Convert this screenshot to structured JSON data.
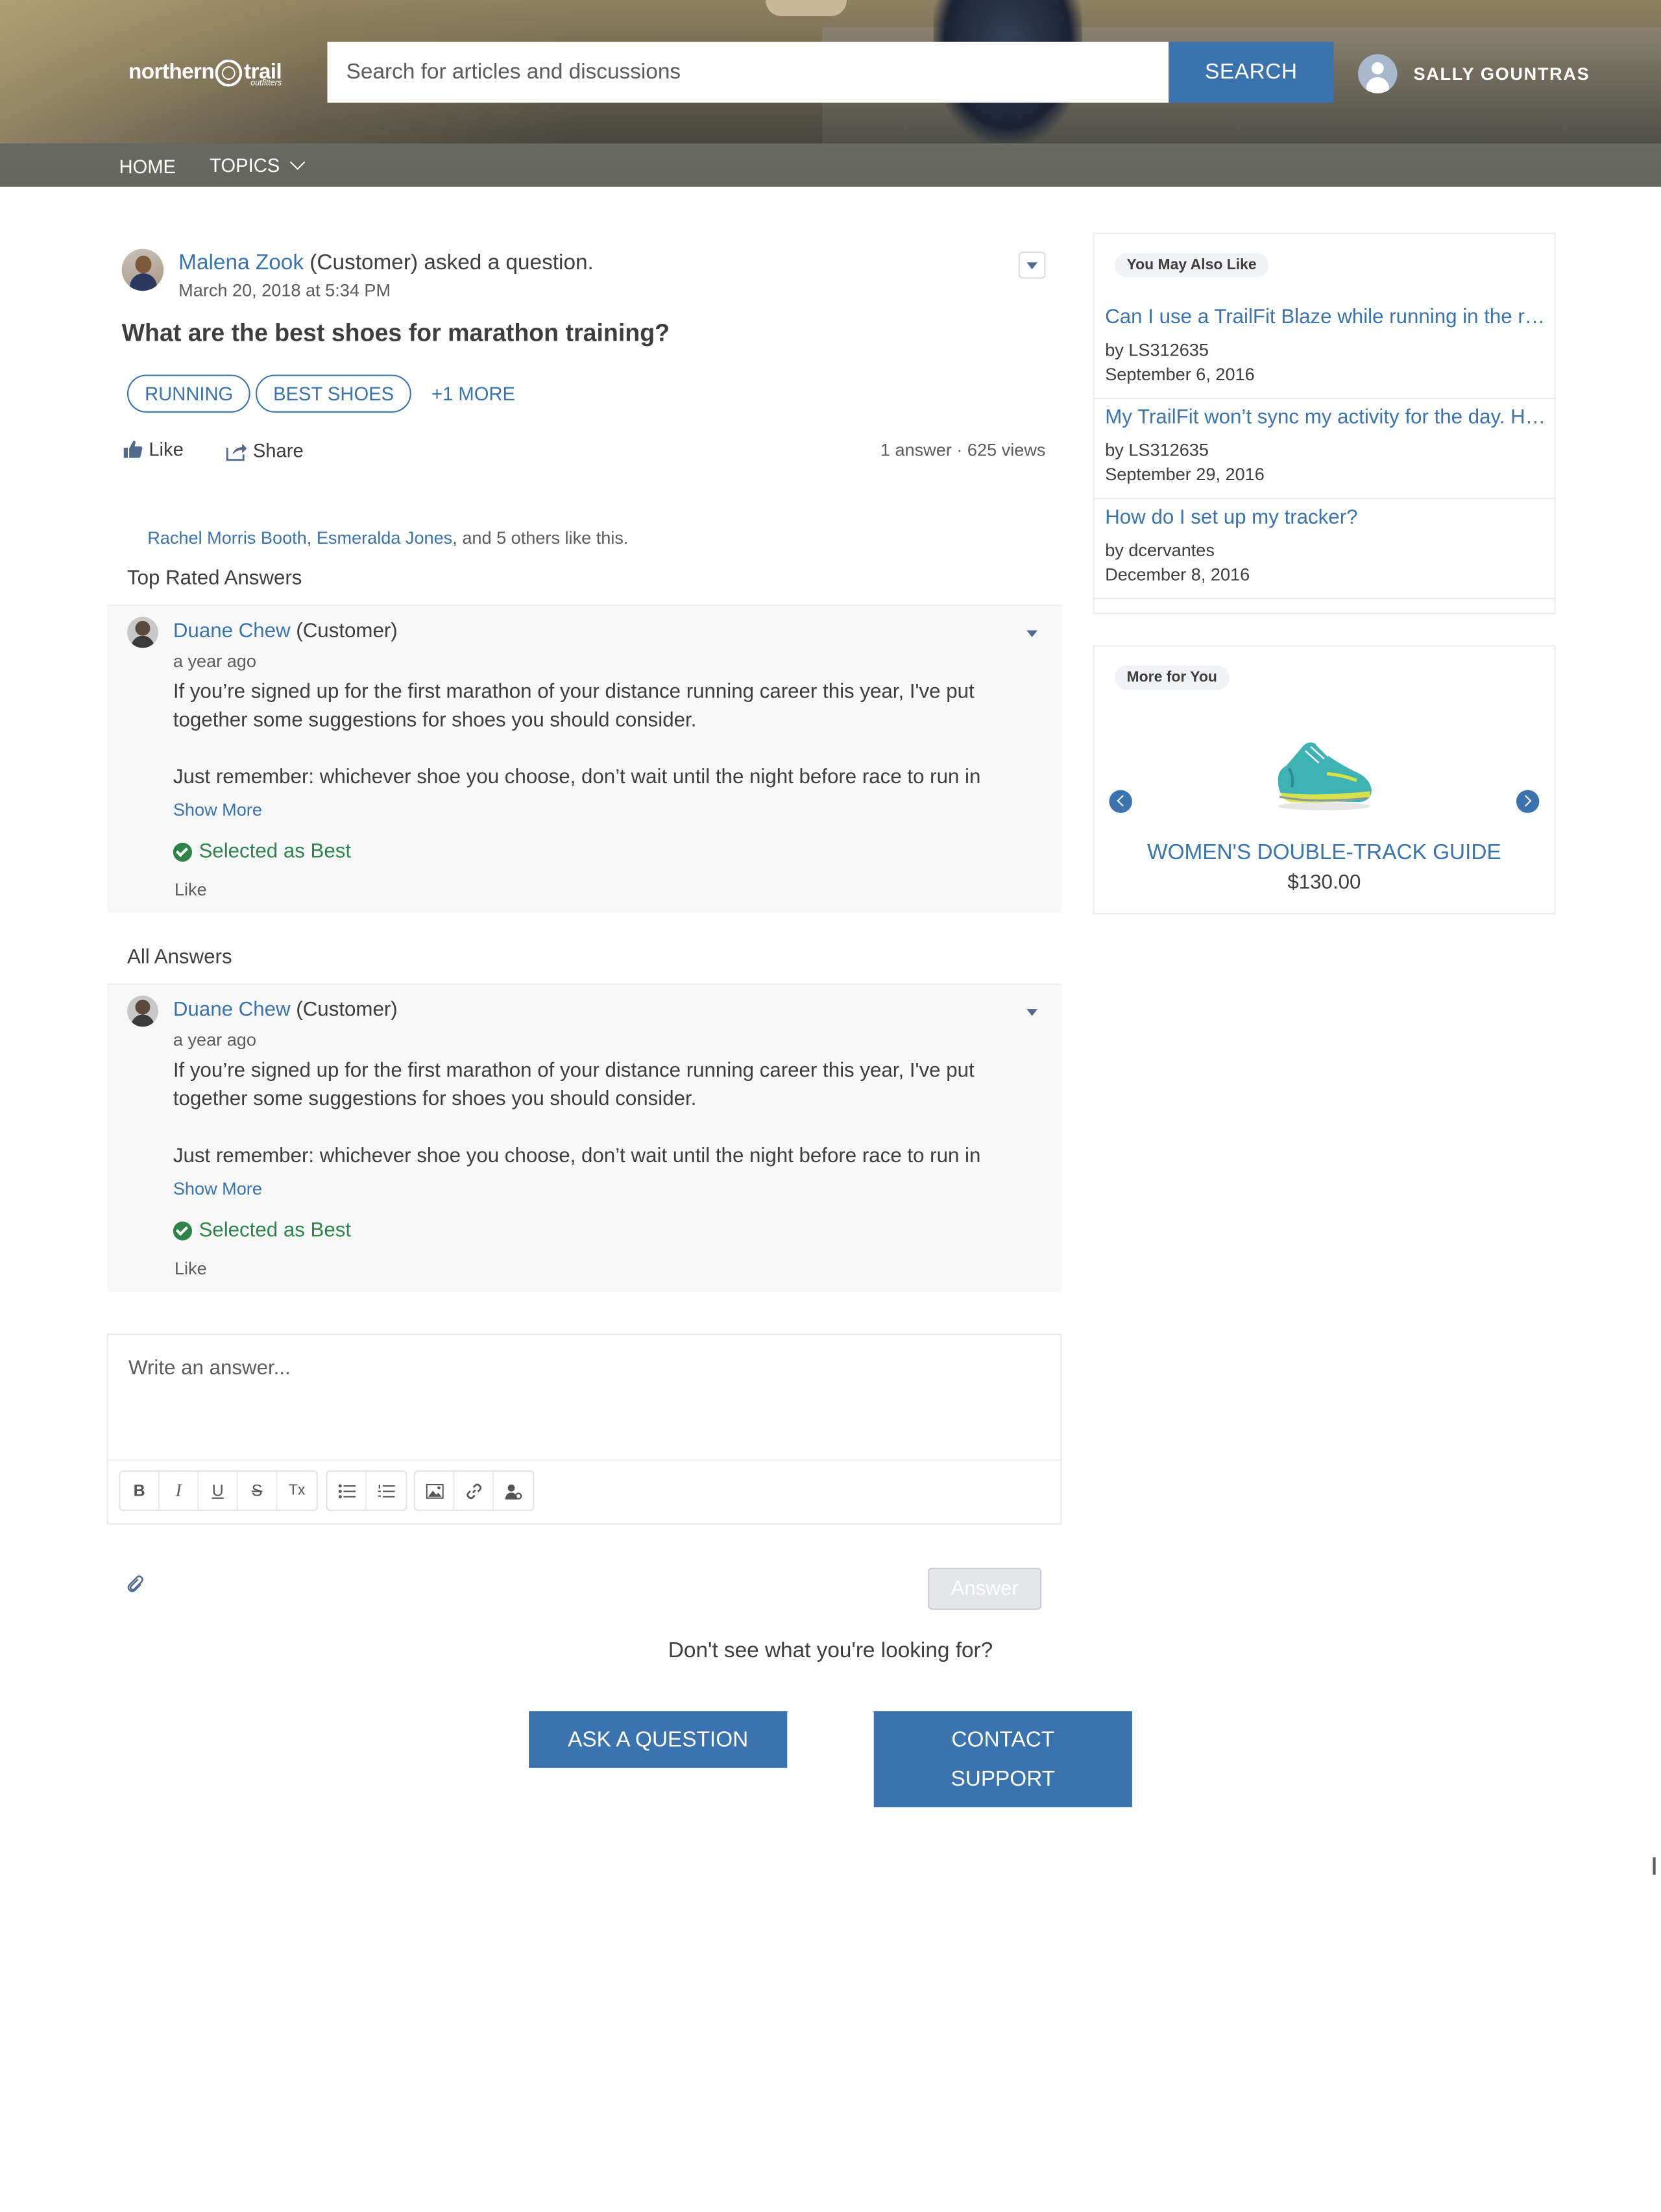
{
  "header": {
    "logo": {
      "word1": "northern",
      "word2": "trail",
      "sub": "outfitters"
    },
    "search": {
      "placeholder": "Search for articles and discussions",
      "button_label": "SEARCH"
    },
    "user": {
      "name": "SALLY GOUNTRAS"
    },
    "nav": {
      "home": "HOME",
      "topics": "TOPICS"
    }
  },
  "question": {
    "author": "Malena Zook",
    "author_suffix": " (Customer) asked a question.",
    "date": "March 20, 2018 at 5:34 PM",
    "title": "What are the best shoes for marathon training?",
    "tags": [
      "RUNNING",
      "BEST SHOES"
    ],
    "more_tags": "+1 MORE",
    "like_label": "Like",
    "share_label": "Share",
    "stats": "1 answer · 625 views",
    "likers": {
      "person1": "Rachel Morris Booth",
      "sep": ", ",
      "person2": "Esmeralda Jones",
      "rest": ", and 5 others like this."
    }
  },
  "sections": {
    "top_rated": "Top Rated Answers",
    "all_answers": "All Answers"
  },
  "answers": {
    "top": {
      "author": "Duane Chew",
      "role": " (Customer)",
      "time": "a year ago",
      "body_p1": "If you’re signed up for the first marathon of your distance running career this year, I've put together some suggestions for shoes you should consider.",
      "body_p2": "Just remember: whichever shoe you choose, don’t wait until the night before race to run in",
      "show_more": "Show More",
      "best_label": "Selected as Best",
      "like_label": "Like"
    },
    "all": {
      "author": "Duane Chew",
      "role": " (Customer)",
      "time": "a year ago",
      "body_p1": "If you’re signed up for the first marathon of your distance running career this year, I've put together some suggestions for shoes you should consider.",
      "body_p2": "Just remember: whichever shoe you choose, don’t wait until the night before race to run in",
      "show_more": "Show More",
      "best_label": "Selected as Best",
      "like_label": "Like"
    }
  },
  "composer": {
    "placeholder": "Write an answer...",
    "toolbar": {
      "bold": "B",
      "italic": "I",
      "underline": "U",
      "strike": "S",
      "clear": "Tx"
    },
    "submit_label": "Answer"
  },
  "footer": {
    "prompt": "Don't see what you're looking for?",
    "ask_label": "ASK A QUESTION",
    "contact_label": "CONTACT SUPPORT"
  },
  "sidebar": {
    "related": {
      "badge": "You May Also Like",
      "items": [
        {
          "title": "Can I use a TrailFit Blaze while running in the rain?",
          "by": "by LS312635",
          "date": "September 6, 2016"
        },
        {
          "title": "My TrailFit won’t sync my activity for the day. Help?",
          "by": "by LS312635",
          "date": "September 29, 2016"
        },
        {
          "title": "How do I set up my tracker?",
          "by": "by dcervantes",
          "date": "December 8, 2016"
        }
      ]
    },
    "more": {
      "badge": "More for You",
      "product_name": "WOMEN'S DOUBLE-TRACK GUIDE",
      "product_price": "$130.00"
    }
  },
  "colors": {
    "brand_blue": "#3b73ae",
    "success_green": "#2e844a",
    "text": "#3e3e3c",
    "muted": "#5c5c5c"
  },
  "icons": [
    "like-icon",
    "share-icon",
    "check-circle-icon",
    "chevron-down-icon",
    "attachment-icon",
    "image-icon",
    "link-icon",
    "user-icon",
    "chevron-left-icon",
    "chevron-right-icon"
  ]
}
